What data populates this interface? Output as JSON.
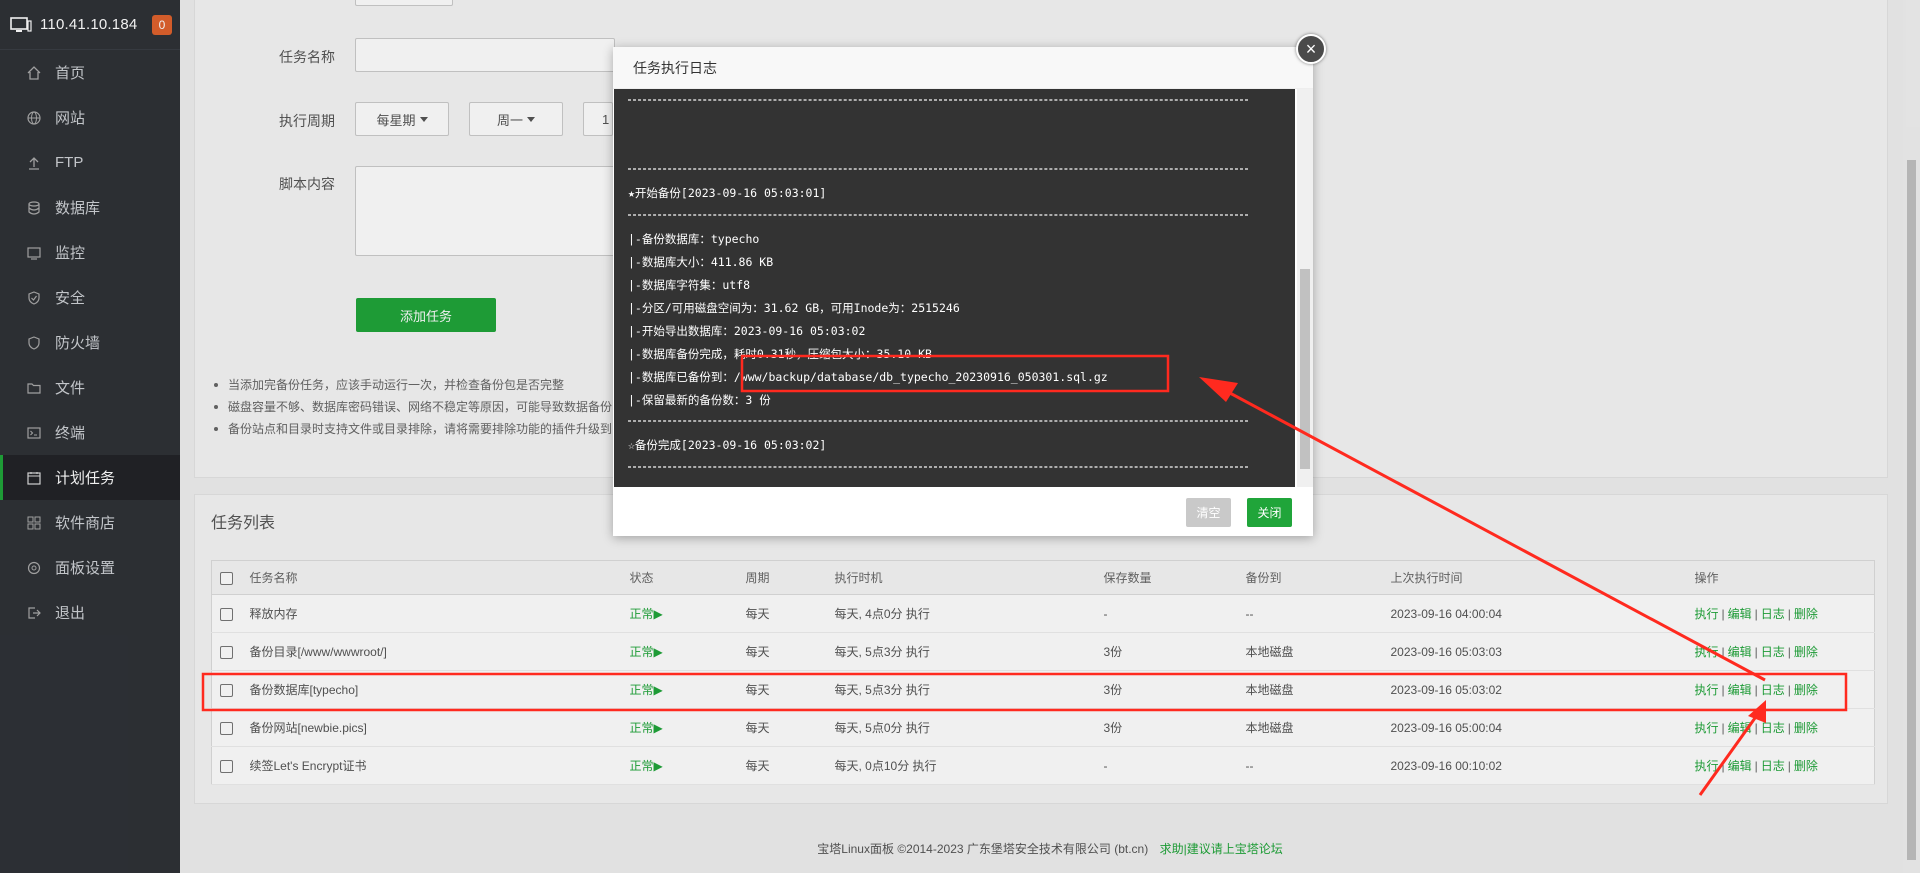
{
  "sidebar": {
    "ip": "110.41.10.184",
    "badge": "0",
    "items": [
      {
        "label": "首页"
      },
      {
        "label": "网站"
      },
      {
        "label": "FTP"
      },
      {
        "label": "数据库"
      },
      {
        "label": "监控"
      },
      {
        "label": "安全"
      },
      {
        "label": "防火墙"
      },
      {
        "label": "文件"
      },
      {
        "label": "终端"
      },
      {
        "label": "计划任务"
      },
      {
        "label": "软件商店"
      },
      {
        "label": "面板设置"
      },
      {
        "label": "退出"
      }
    ]
  },
  "form": {
    "task_name_label": "任务名称",
    "period_label": "执行周期",
    "period_select": "每星期",
    "weekday_select": "周一",
    "hour_select": "1",
    "script_label": "脚本内容",
    "add_button": "添加任务",
    "notes": [
      "当添加完备份任务，应该手动运行一次，并检查备份包是否完整",
      "磁盘容量不够、数据库密码错误、网络不稳定等原因，可能导致数据备份",
      "备份站点和目录时支持文件或目录排除，请将需要排除功能的插件升级到"
    ]
  },
  "task_list": {
    "title": "任务列表",
    "headers": [
      "任务名称",
      "状态",
      "周期",
      "执行时机",
      "保存数量",
      "备份到",
      "上次执行时间",
      "操作"
    ],
    "rows": [
      {
        "name": "释放内存",
        "status": "正常▶",
        "cycle": "每天",
        "timing": "每天, 4点0分 执行",
        "keep": "-",
        "backup": "--",
        "last": "2023-09-16 04:00:04"
      },
      {
        "name": "备份目录[/www/wwwroot/]",
        "status": "正常▶",
        "cycle": "每天",
        "timing": "每天, 5点3分 执行",
        "keep": "3份",
        "backup": "本地磁盘",
        "last": "2023-09-16 05:03:03"
      },
      {
        "name": "备份数据库[typecho]",
        "status": "正常▶",
        "cycle": "每天",
        "timing": "每天, 5点3分 执行",
        "keep": "3份",
        "backup": "本地磁盘",
        "last": "2023-09-16 05:03:02"
      },
      {
        "name": "备份网站[newbie.pics]",
        "status": "正常▶",
        "cycle": "每天",
        "timing": "每天, 5点0分 执行",
        "keep": "3份",
        "backup": "本地磁盘",
        "last": "2023-09-16 05:00:04"
      },
      {
        "name": "续签Let's Encrypt证书",
        "status": "正常▶",
        "cycle": "每天",
        "timing": "每天, 0点10分 执行",
        "keep": "-",
        "backup": "--",
        "last": "2023-09-16 00:10:02"
      }
    ],
    "ops": {
      "run": "执行",
      "edit": "编辑",
      "log": "日志",
      "delete": "删除",
      "sep": "|"
    }
  },
  "footer": {
    "copyright": "宝塔Linux面板 ©2014-2023 广东堡塔安全技术有限公司 (bt.cn)",
    "link": "求助|建议请上宝塔论坛"
  },
  "modal": {
    "title": "任务执行日志",
    "close_glyph": "×",
    "log": {
      "start": "★开始备份[2023-09-16 05:03:01]",
      "db": "|-备份数据库：typecho",
      "size": "|-数据库大小：411.86 KB",
      "charset": "|-数据库字符集：utf8",
      "disk": "|-分区/可用磁盘空间为：31.62 GB，可用Inode为：2515246",
      "export": "|-开始导出数据库：2023-09-16 05:03:02",
      "done": "|-数据库备份完成，耗时0.31秒，压缩包大小：35.10 KB",
      "saved_prefix": "|-数据库已备份到：",
      "saved_path": "/www/backup/database/db_typecho_20230916_050301.sql.gz",
      "keep": "|-保留最新的备份数：3 份",
      "finish": "☆备份完成[2023-09-16 05:03:02]"
    },
    "clear_button": "清空",
    "close_button": "关闭"
  },
  "colors": {
    "accent": "#20a53a",
    "annotation": "#ff2a1f",
    "sidebar": "#2f3237"
  }
}
